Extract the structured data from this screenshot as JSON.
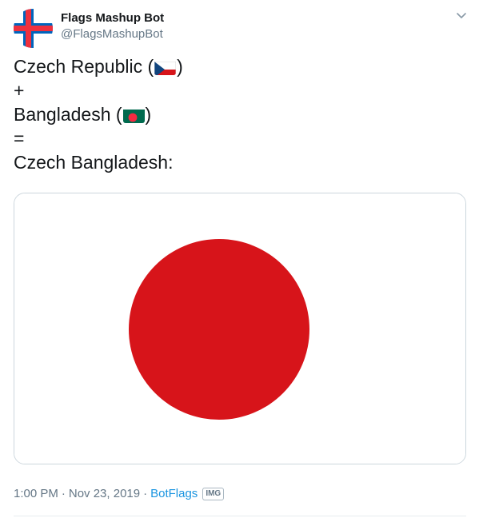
{
  "author": {
    "display_name": "Flags Mashup Bot",
    "handle": "@FlagsMashupBot",
    "avatar_icon": "faroe-islands-flag-icon"
  },
  "menu": {
    "icon": "chevron-down-icon"
  },
  "tweet": {
    "line1_text": "Czech Republic (",
    "line1_close": ")",
    "line1_flag": "czech-republic-flag-icon",
    "line2": "+",
    "line3_text": "Bangladesh (",
    "line3_close": ")",
    "line3_flag": "bangladesh-flag-icon",
    "line4": "=",
    "line5": "Czech Bangladesh:"
  },
  "media": {
    "description": "flag-image",
    "background_color": "#ffffff",
    "circle_color": "#d7141a"
  },
  "footer": {
    "time": "1:00 PM",
    "separator1": "·",
    "date": "Nov 23, 2019",
    "separator2": "·",
    "source": "BotFlags",
    "badge": "IMG"
  },
  "colors": {
    "text": "#14171a",
    "secondary": "#657786",
    "link": "#1b95e0",
    "border": "#ccd6dd"
  }
}
